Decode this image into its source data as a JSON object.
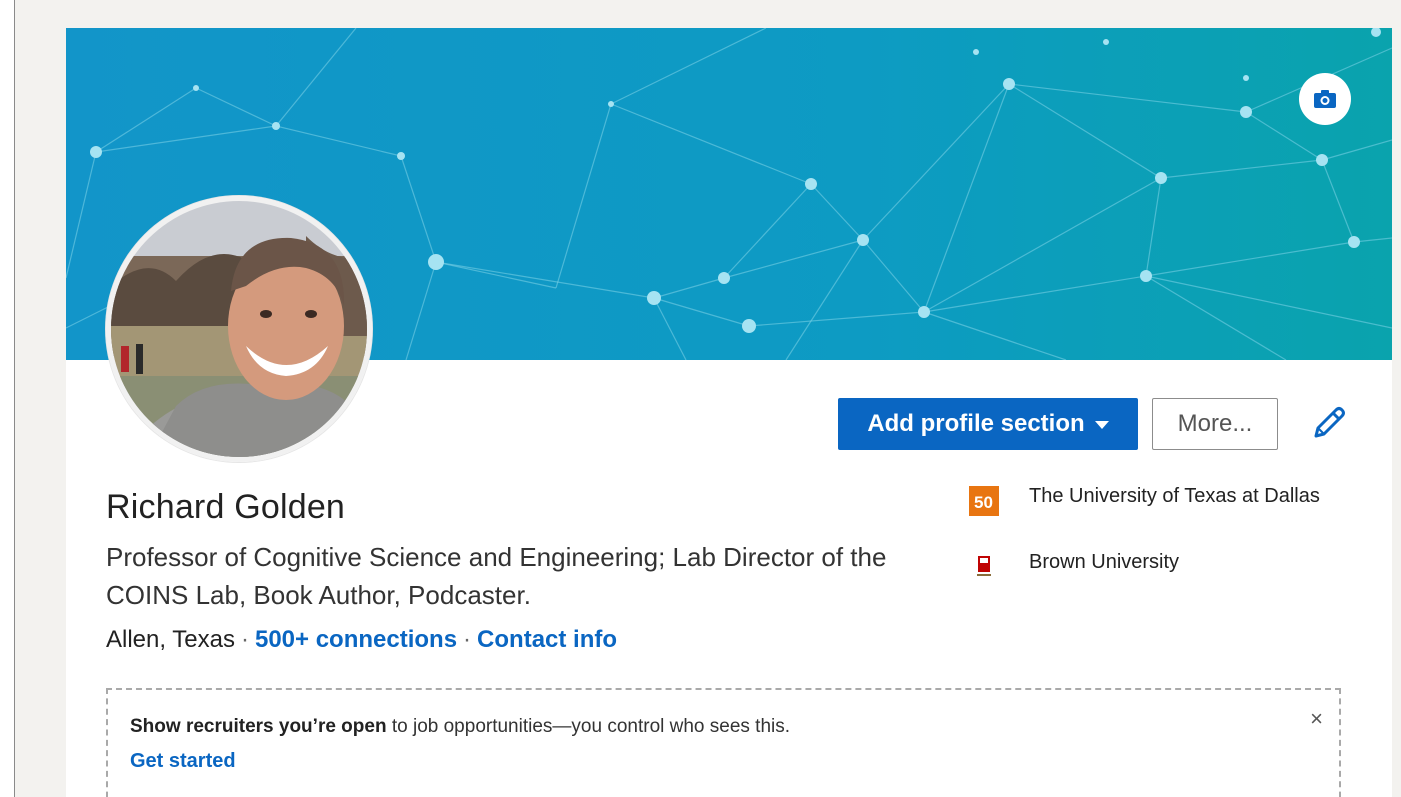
{
  "profile": {
    "name": "Richard Golden",
    "headline": "Professor of Cognitive Science and Engineering; Lab Director of the COINS Lab, Book Author, Podcaster.",
    "location": "Allen, Texas",
    "separator": "·",
    "connections": "500+ connections",
    "contact_info": "Contact info"
  },
  "actions": {
    "add_section_label": "Add profile section",
    "more_label": "More..."
  },
  "education": [
    {
      "school": "The University of Texas at Dallas",
      "logo_text": "50",
      "logo_color": "#e87511"
    },
    {
      "school": "Brown University",
      "logo_color": "#c00404"
    }
  ],
  "notice": {
    "bold_text": "Show recruiters you’re open",
    "rest_text": " to job opportunities—you control who sees this.",
    "link_label": "Get started",
    "close_symbol": "×"
  },
  "icons": {
    "banner_camera": "camera-icon",
    "edit": "pencil-icon",
    "dropdown": "caret-down-icon",
    "close": "close-icon"
  },
  "colors": {
    "brand_blue": "#0a66c2",
    "banner_start": "#0f97c6",
    "banner_end": "#0a9fb0"
  }
}
